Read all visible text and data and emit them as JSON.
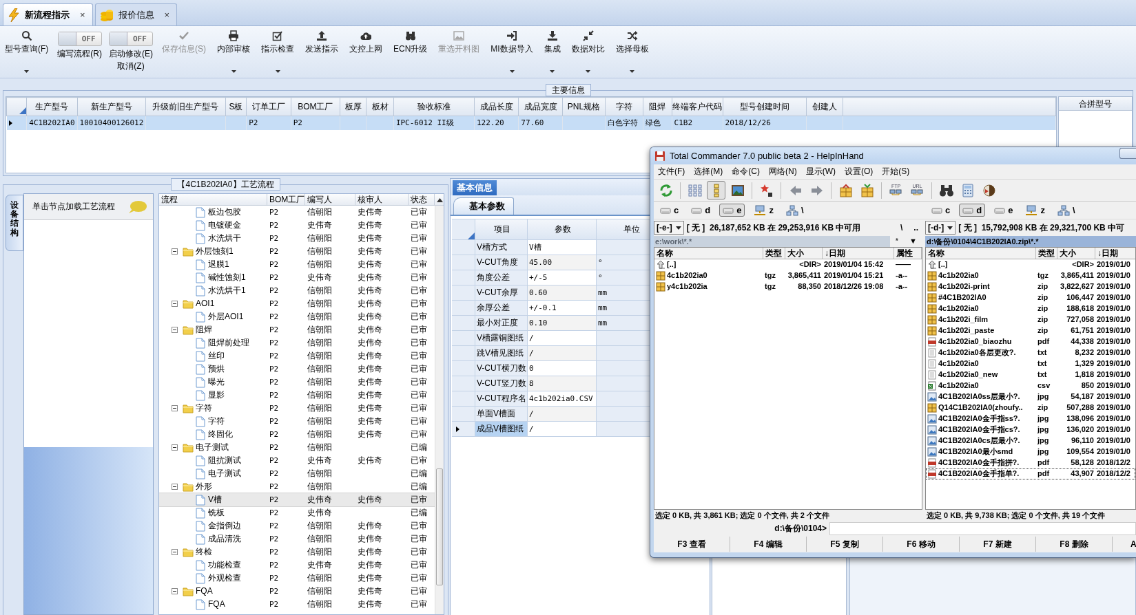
{
  "tabs": [
    {
      "kind": "flow",
      "label": "新流程指示",
      "close": "×",
      "selected": true
    },
    {
      "kind": "quote",
      "label": "报价信息",
      "close": "×",
      "selected": false
    }
  ],
  "toolbar": [
    {
      "kind": "search",
      "label": "型号查询(F)",
      "dropdown": true,
      "disabled": false
    },
    {
      "kind": "toggle",
      "toggle_text": "OFF",
      "on": false,
      "label": "编写流程(R)"
    },
    {
      "kind": "toggle",
      "toggle_text": "OFF",
      "on": false,
      "label": "启动修改(E)",
      "label_2": "取消(Z)"
    },
    {
      "kind": "check",
      "label": "保存信息(S)",
      "dropdown": false,
      "disabled": true
    },
    {
      "kind": "print",
      "label": "内部审核",
      "dropdown": true,
      "disabled": false
    },
    {
      "kind": "checkbox",
      "label": "指示检查",
      "dropdown": true,
      "disabled": false
    },
    {
      "kind": "upload",
      "label": "发送指示",
      "dropdown": false,
      "disabled": false
    },
    {
      "kind": "cloud",
      "label": "文控上网",
      "dropdown": false,
      "disabled": false
    },
    {
      "kind": "binoculars",
      "label": "ECN升级",
      "dropdown": false,
      "disabled": false
    },
    {
      "kind": "image",
      "label": "重选开料图",
      "dropdown": false,
      "disabled": true
    },
    {
      "kind": "signin",
      "label": "MI数据导入",
      "dropdown": true,
      "disabled": false
    },
    {
      "kind": "download",
      "label": "集成",
      "dropdown": true,
      "disabled": false
    },
    {
      "kind": "compress",
      "label": "数据对比",
      "dropdown": true,
      "disabled": false
    },
    {
      "kind": "shuffle",
      "label": "选择母板",
      "dropdown": true,
      "disabled": false
    }
  ],
  "main_info": {
    "title": "主要信息",
    "columns": [
      "生产型号",
      "新生产型号",
      "升级前旧生产型号",
      "S板",
      "订单工厂",
      "BOM工厂",
      "板厚",
      "板材",
      "验收标准",
      "成品长度",
      "成品宽度",
      "PNL规格",
      "字符",
      "阻焊",
      "终端客户代码",
      "型号创建时间",
      "创建人"
    ],
    "rows": [
      {
        "selected": true,
        "cells": [
          "4C1B202IA0",
          "10010400126012",
          null,
          null,
          "P2",
          "P2",
          null,
          null,
          "IPC-6012 II级",
          "122.20",
          "77.60",
          null,
          "白色字符",
          "绿色",
          "C1B2",
          "2018/12/26",
          null
        ]
      }
    ],
    "side_panel": {
      "title": "合拼型号"
    }
  },
  "process": {
    "title": "【4C1B202IA0】工艺流程",
    "side_tab": "设备结构",
    "hint": "单击节点加载工艺流程",
    "columns": [
      "流程",
      "BOM工厂",
      "编写人",
      "核审人",
      "状态"
    ],
    "continued_rows": [
      {
        "name": "板边包胶",
        "bom": "P2",
        "writer": "信朝阳",
        "reviewer": "史伟奇",
        "status": "已审",
        "selected": false
      },
      {
        "name": "电镀硬金",
        "bom": "P2",
        "writer": "史伟奇",
        "reviewer": "史伟奇",
        "status": "已审",
        "selected": false
      },
      {
        "name": "水洗烘干",
        "bom": "P2",
        "writer": "信朝阳",
        "reviewer": "史伟奇",
        "status": "已审",
        "selected": false
      }
    ],
    "nodes": [
      {
        "name": "外层蚀刻1",
        "bom": "P2",
        "writer": "信朝阳",
        "reviewer": "史伟奇",
        "status": "已审",
        "selected": false,
        "expanded": true,
        "children": [
          {
            "name": "退膜1",
            "bom": "P2",
            "writer": "信朝阳",
            "reviewer": "史伟奇",
            "status": "已审",
            "selected": false
          },
          {
            "name": "碱性蚀刻1",
            "bom": "P2",
            "writer": "史伟奇",
            "reviewer": "史伟奇",
            "status": "已审",
            "selected": false
          },
          {
            "name": "水洗烘干1",
            "bom": "P2",
            "writer": "信朝阳",
            "reviewer": "史伟奇",
            "status": "已审",
            "selected": false
          }
        ]
      },
      {
        "name": "AOI1",
        "bom": "P2",
        "writer": "信朝阳",
        "reviewer": "史伟奇",
        "status": "已审",
        "selected": false,
        "expanded": true,
        "children": [
          {
            "name": "外层AOI1",
            "bom": "P2",
            "writer": "信朝阳",
            "reviewer": "史伟奇",
            "status": "已审",
            "selected": false
          }
        ]
      },
      {
        "name": "阻焊",
        "bom": "P2",
        "writer": "信朝阳",
        "reviewer": "史伟奇",
        "status": "已审",
        "selected": false,
        "expanded": true,
        "children": [
          {
            "name": "阻焊前处理",
            "bom": "P2",
            "writer": "信朝阳",
            "reviewer": "史伟奇",
            "status": "已审",
            "selected": false
          },
          {
            "name": "丝印",
            "bom": "P2",
            "writer": "信朝阳",
            "reviewer": "史伟奇",
            "status": "已审",
            "selected": false
          },
          {
            "name": "预烘",
            "bom": "P2",
            "writer": "信朝阳",
            "reviewer": "史伟奇",
            "status": "已审",
            "selected": false
          },
          {
            "name": "曝光",
            "bom": "P2",
            "writer": "信朝阳",
            "reviewer": "史伟奇",
            "status": "已审",
            "selected": false
          },
          {
            "name": "显影",
            "bom": "P2",
            "writer": "信朝阳",
            "reviewer": "史伟奇",
            "status": "已审",
            "selected": false
          }
        ]
      },
      {
        "name": "字符",
        "bom": "P2",
        "writer": "信朝阳",
        "reviewer": "史伟奇",
        "status": "已审",
        "selected": false,
        "expanded": true,
        "children": [
          {
            "name": "字符",
            "bom": "P2",
            "writer": "信朝阳",
            "reviewer": "史伟奇",
            "status": "已审",
            "selected": false
          },
          {
            "name": "终固化",
            "bom": "P2",
            "writer": "信朝阳",
            "reviewer": "史伟奇",
            "status": "已审",
            "selected": false
          }
        ]
      },
      {
        "name": "电子测试",
        "bom": "P2",
        "writer": "信朝阳",
        "status": "已编",
        "selected": false,
        "expanded": true,
        "children": [
          {
            "name": "阻抗测试",
            "bom": "P2",
            "writer": "史伟奇",
            "reviewer": "史伟奇",
            "status": "已审",
            "selected": false
          },
          {
            "name": "电子测试",
            "bom": "P2",
            "writer": "信朝阳",
            "status": "已编",
            "selected": false
          }
        ]
      },
      {
        "name": "外形",
        "bom": "P2",
        "writer": "信朝阳",
        "status": "已编",
        "selected": false,
        "expanded": true,
        "children": [
          {
            "name": "V槽",
            "bom": "P2",
            "writer": "史伟奇",
            "reviewer": "史伟奇",
            "status": "已审",
            "selected": true
          },
          {
            "name": "铣板",
            "bom": "P2",
            "writer": "史伟奇",
            "status": "已编",
            "selected": false
          },
          {
            "name": "金指倒边",
            "bom": "P2",
            "writer": "信朝阳",
            "reviewer": "史伟奇",
            "status": "已审",
            "selected": false
          },
          {
            "name": "成品清洗",
            "bom": "P2",
            "writer": "信朝阳",
            "reviewer": "史伟奇",
            "status": "已审",
            "selected": false
          }
        ]
      },
      {
        "name": "终检",
        "bom": "P2",
        "writer": "信朝阳",
        "reviewer": "史伟奇",
        "status": "已审",
        "selected": false,
        "expanded": true,
        "children": [
          {
            "name": "功能检查",
            "bom": "P2",
            "writer": "史伟奇",
            "reviewer": "史伟奇",
            "status": "已审",
            "selected": false
          },
          {
            "name": "外观检查",
            "bom": "P2",
            "writer": "信朝阳",
            "reviewer": "史伟奇",
            "status": "已审",
            "selected": false
          }
        ]
      },
      {
        "name": "FQA",
        "bom": "P2",
        "writer": "信朝阳",
        "reviewer": "史伟奇",
        "status": "已审",
        "selected": false,
        "expanded": true,
        "children": [
          {
            "name": "FQA",
            "bom": "P2",
            "writer": "信朝阳",
            "reviewer": "史伟奇",
            "status": "已审",
            "selected": false
          }
        ]
      }
    ]
  },
  "basic_info": {
    "tabs": [
      {
        "label": "基本信息",
        "selected": true
      }
    ],
    "subtabs": [
      {
        "label": "基本参数",
        "selected": true
      }
    ],
    "columns": [
      "项目",
      "参数",
      "单位"
    ],
    "rows": [
      {
        "item": "V槽方式",
        "value": "V槽",
        "selected": false
      },
      {
        "item": "V-CUT角度",
        "value": "45.00",
        "unit": "°",
        "selected": false
      },
      {
        "item": "角度公差",
        "value": "+/-5",
        "unit": "°",
        "selected": false
      },
      {
        "item": "V-CUT余厚",
        "value": "0.60",
        "unit": "mm",
        "selected": false
      },
      {
        "item": "余厚公差",
        "value": "+/-0.1",
        "unit": "mm",
        "selected": false
      },
      {
        "item": "最小对正度",
        "value": "0.10",
        "unit": "mm",
        "selected": false
      },
      {
        "item": "V槽露铜图纸",
        "value": "/",
        "selected": false
      },
      {
        "item": "跳V槽见图纸",
        "value": "/",
        "selected": false
      },
      {
        "item": "V-CUT横刀数",
        "value": "0",
        "selected": false
      },
      {
        "item": "V-CUT竖刀数",
        "value": "8",
        "selected": false
      },
      {
        "item": "V-CUT程序名",
        "value": "4c1b202ia0.CSV",
        "selected": false
      },
      {
        "item": "单面V槽面",
        "value": "/",
        "selected": false
      },
      {
        "item": "成品V槽图纸",
        "value": "/",
        "selected": true
      }
    ]
  },
  "file_manager": {
    "title": "Total Commander 7.0 public beta 2 - HelpInHand",
    "menu": [
      "文件(F)",
      "选择(M)",
      "命令(C)",
      "网络(N)",
      "显示(W)",
      "设置(O)",
      "开始(S)"
    ],
    "toolbar": [
      {
        "kind": "refresh",
        "pressed": false
      },
      {
        "kind": "brief",
        "pressed": false
      },
      {
        "kind": "full",
        "pressed": true
      },
      {
        "kind": "thumbs",
        "pressed": false
      },
      {
        "kind": "star",
        "pressed": false
      },
      {
        "kind": "back",
        "pressed": false
      },
      {
        "kind": "forward",
        "pressed": false
      },
      {
        "kind": "pack",
        "pressed": false
      },
      {
        "kind": "unpack",
        "pressed": false
      },
      {
        "kind": "ftp",
        "caption": "FTP",
        "pressed": false
      },
      {
        "kind": "url",
        "caption": "URL",
        "pressed": false
      },
      {
        "kind": "binoculars",
        "pressed": false
      },
      {
        "kind": "calculator",
        "pressed": false
      },
      {
        "kind": "app",
        "pressed": false
      }
    ],
    "panels": [
      {
        "active": false,
        "drives": [
          {
            "kind": "disk",
            "label": "c",
            "selected": false
          },
          {
            "kind": "disk",
            "label": "d",
            "selected": false
          },
          {
            "kind": "disk",
            "label": "e",
            "selected": true
          },
          {
            "kind": "network",
            "label": "z",
            "selected": false
          },
          {
            "kind": "tree",
            "label": "\\",
            "selected": false
          }
        ],
        "drive_select": "[-e-]",
        "free_space": "[ 无 ]  26,187,652 KB 在 29,253,916 KB 中可用",
        "nav_buttons": [
          "\\",
          ".."
        ],
        "path": "e:\\work\\*.*",
        "path_buttons": [
          "*",
          "▼"
        ],
        "columns": [
          "名称",
          "类型",
          "大小",
          "↓日期",
          "属性"
        ],
        "files": [
          {
            "kind": "up",
            "name": "[..]",
            "size": "<DIR>",
            "date": "2019/01/04 15:42",
            "attributes": "——",
            "focused": false
          },
          {
            "kind": "archive",
            "name": "4c1b202ia0",
            "type": "tgz",
            "size": "3,865,411",
            "date": "2019/01/04 15:21",
            "attributes": "-a--",
            "focused": false
          },
          {
            "kind": "archive",
            "name": "y4c1b202ia",
            "type": "tgz",
            "size": "88,350",
            "date": "2018/12/26 19:08",
            "attributes": "-a--",
            "focused": false
          }
        ],
        "status": "选定 0 KB, 共 3,861 KB; 选定 0 个文件, 共 2 个文件"
      },
      {
        "active": true,
        "drives": [
          {
            "kind": "disk",
            "label": "c",
            "selected": false
          },
          {
            "kind": "disk",
            "label": "d",
            "selected": true
          },
          {
            "kind": "disk",
            "label": "e",
            "selected": false
          },
          {
            "kind": "network",
            "label": "z",
            "selected": false
          },
          {
            "kind": "tree",
            "label": "\\",
            "selected": false
          }
        ],
        "drive_select": "[-d-]",
        "free_space": "[ 无 ]  15,792,908 KB 在 29,321,700 KB 中可",
        "path": "d:\\备份\\0104\\4C1B202IA0.zip\\*.*",
        "columns": [
          "名称",
          "类型",
          "大小",
          "↓日期"
        ],
        "files": [
          {
            "kind": "up",
            "name": "[..]",
            "size": "<DIR>",
            "date": "2019/01/0",
            "focused": false
          },
          {
            "kind": "archive",
            "name": "4c1b202ia0",
            "type": "tgz",
            "size": "3,865,411",
            "date": "2019/01/0",
            "focused": false
          },
          {
            "kind": "archive",
            "name": "4c1b202i-print",
            "type": "zip",
            "size": "3,822,627",
            "date": "2019/01/0",
            "focused": false
          },
          {
            "kind": "archive",
            "name": "#4C1B202IA0",
            "type": "zip",
            "size": "106,447",
            "date": "2019/01/0",
            "focused": false
          },
          {
            "kind": "archive",
            "name": "4c1b202ia0",
            "type": "zip",
            "size": "188,618",
            "date": "2019/01/0",
            "focused": false
          },
          {
            "kind": "archive",
            "name": "4c1b202i_film",
            "type": "zip",
            "size": "727,058",
            "date": "2019/01/0",
            "focused": false
          },
          {
            "kind": "archive",
            "name": "4c1b202i_paste",
            "type": "zip",
            "size": "61,751",
            "date": "2019/01/0",
            "focused": false
          },
          {
            "kind": "pdf",
            "name": "4c1b202ia0_biaozhu",
            "type": "pdf",
            "size": "44,338",
            "date": "2019/01/0",
            "focused": false
          },
          {
            "kind": "text",
            "name": "4c1b202ia0各层更改?.",
            "type": "txt",
            "size": "8,232",
            "date": "2019/01/0",
            "focused": false
          },
          {
            "kind": "text",
            "name": "4c1b202ia0",
            "type": "txt",
            "size": "1,329",
            "date": "2019/01/0",
            "focused": false
          },
          {
            "kind": "text",
            "name": "4c1b202ia0_new",
            "type": "txt",
            "size": "1,818",
            "date": "2019/01/0",
            "focused": false
          },
          {
            "kind": "csv",
            "name": "4c1b202ia0",
            "type": "csv",
            "size": "850",
            "date": "2019/01/0",
            "focused": false
          },
          {
            "kind": "image",
            "name": "4C1B202IA0ss层最小?.",
            "type": "jpg",
            "size": "54,187",
            "date": "2019/01/0",
            "focused": false
          },
          {
            "kind": "archive",
            "name": "Q14C1B202IA0(zhoufy..",
            "type": "zip",
            "size": "507,288",
            "date": "2019/01/0",
            "focused": false
          },
          {
            "kind": "image",
            "name": "4C1B202IA0金手指ss?.",
            "type": "jpg",
            "size": "138,096",
            "date": "2019/01/0",
            "focused": false
          },
          {
            "kind": "image",
            "name": "4C1B202IA0金手指cs?.",
            "type": "jpg",
            "size": "136,020",
            "date": "2019/01/0",
            "focused": false
          },
          {
            "kind": "image",
            "name": "4C1B202IA0cs层最小?.",
            "type": "jpg",
            "size": "96,110",
            "date": "2019/01/0",
            "focused": false
          },
          {
            "kind": "image",
            "name": "4C1B202IA0最小smd",
            "type": "jpg",
            "size": "109,554",
            "date": "2019/01/0",
            "focused": false
          },
          {
            "kind": "pdf",
            "name": "4C1B202IA0金手指拼?.",
            "type": "pdf",
            "size": "58,128",
            "date": "2018/12/2",
            "focused": false
          },
          {
            "kind": "pdf",
            "name": "4C1B202IA0金手指单?.",
            "type": "pdf",
            "size": "43,907",
            "date": "2018/12/2",
            "focused": true
          }
        ],
        "status": "选定 0 KB, 共 9,738 KB; 选定 0 个文件, 共 19 个文件"
      }
    ],
    "command_prompt": "d:\\备份\\0104>",
    "function_keys": [
      "F3 查看",
      "F4 编辑",
      "F5 复制",
      "F6 移动",
      "F7 新建",
      "F8 删除",
      "A"
    ]
  }
}
